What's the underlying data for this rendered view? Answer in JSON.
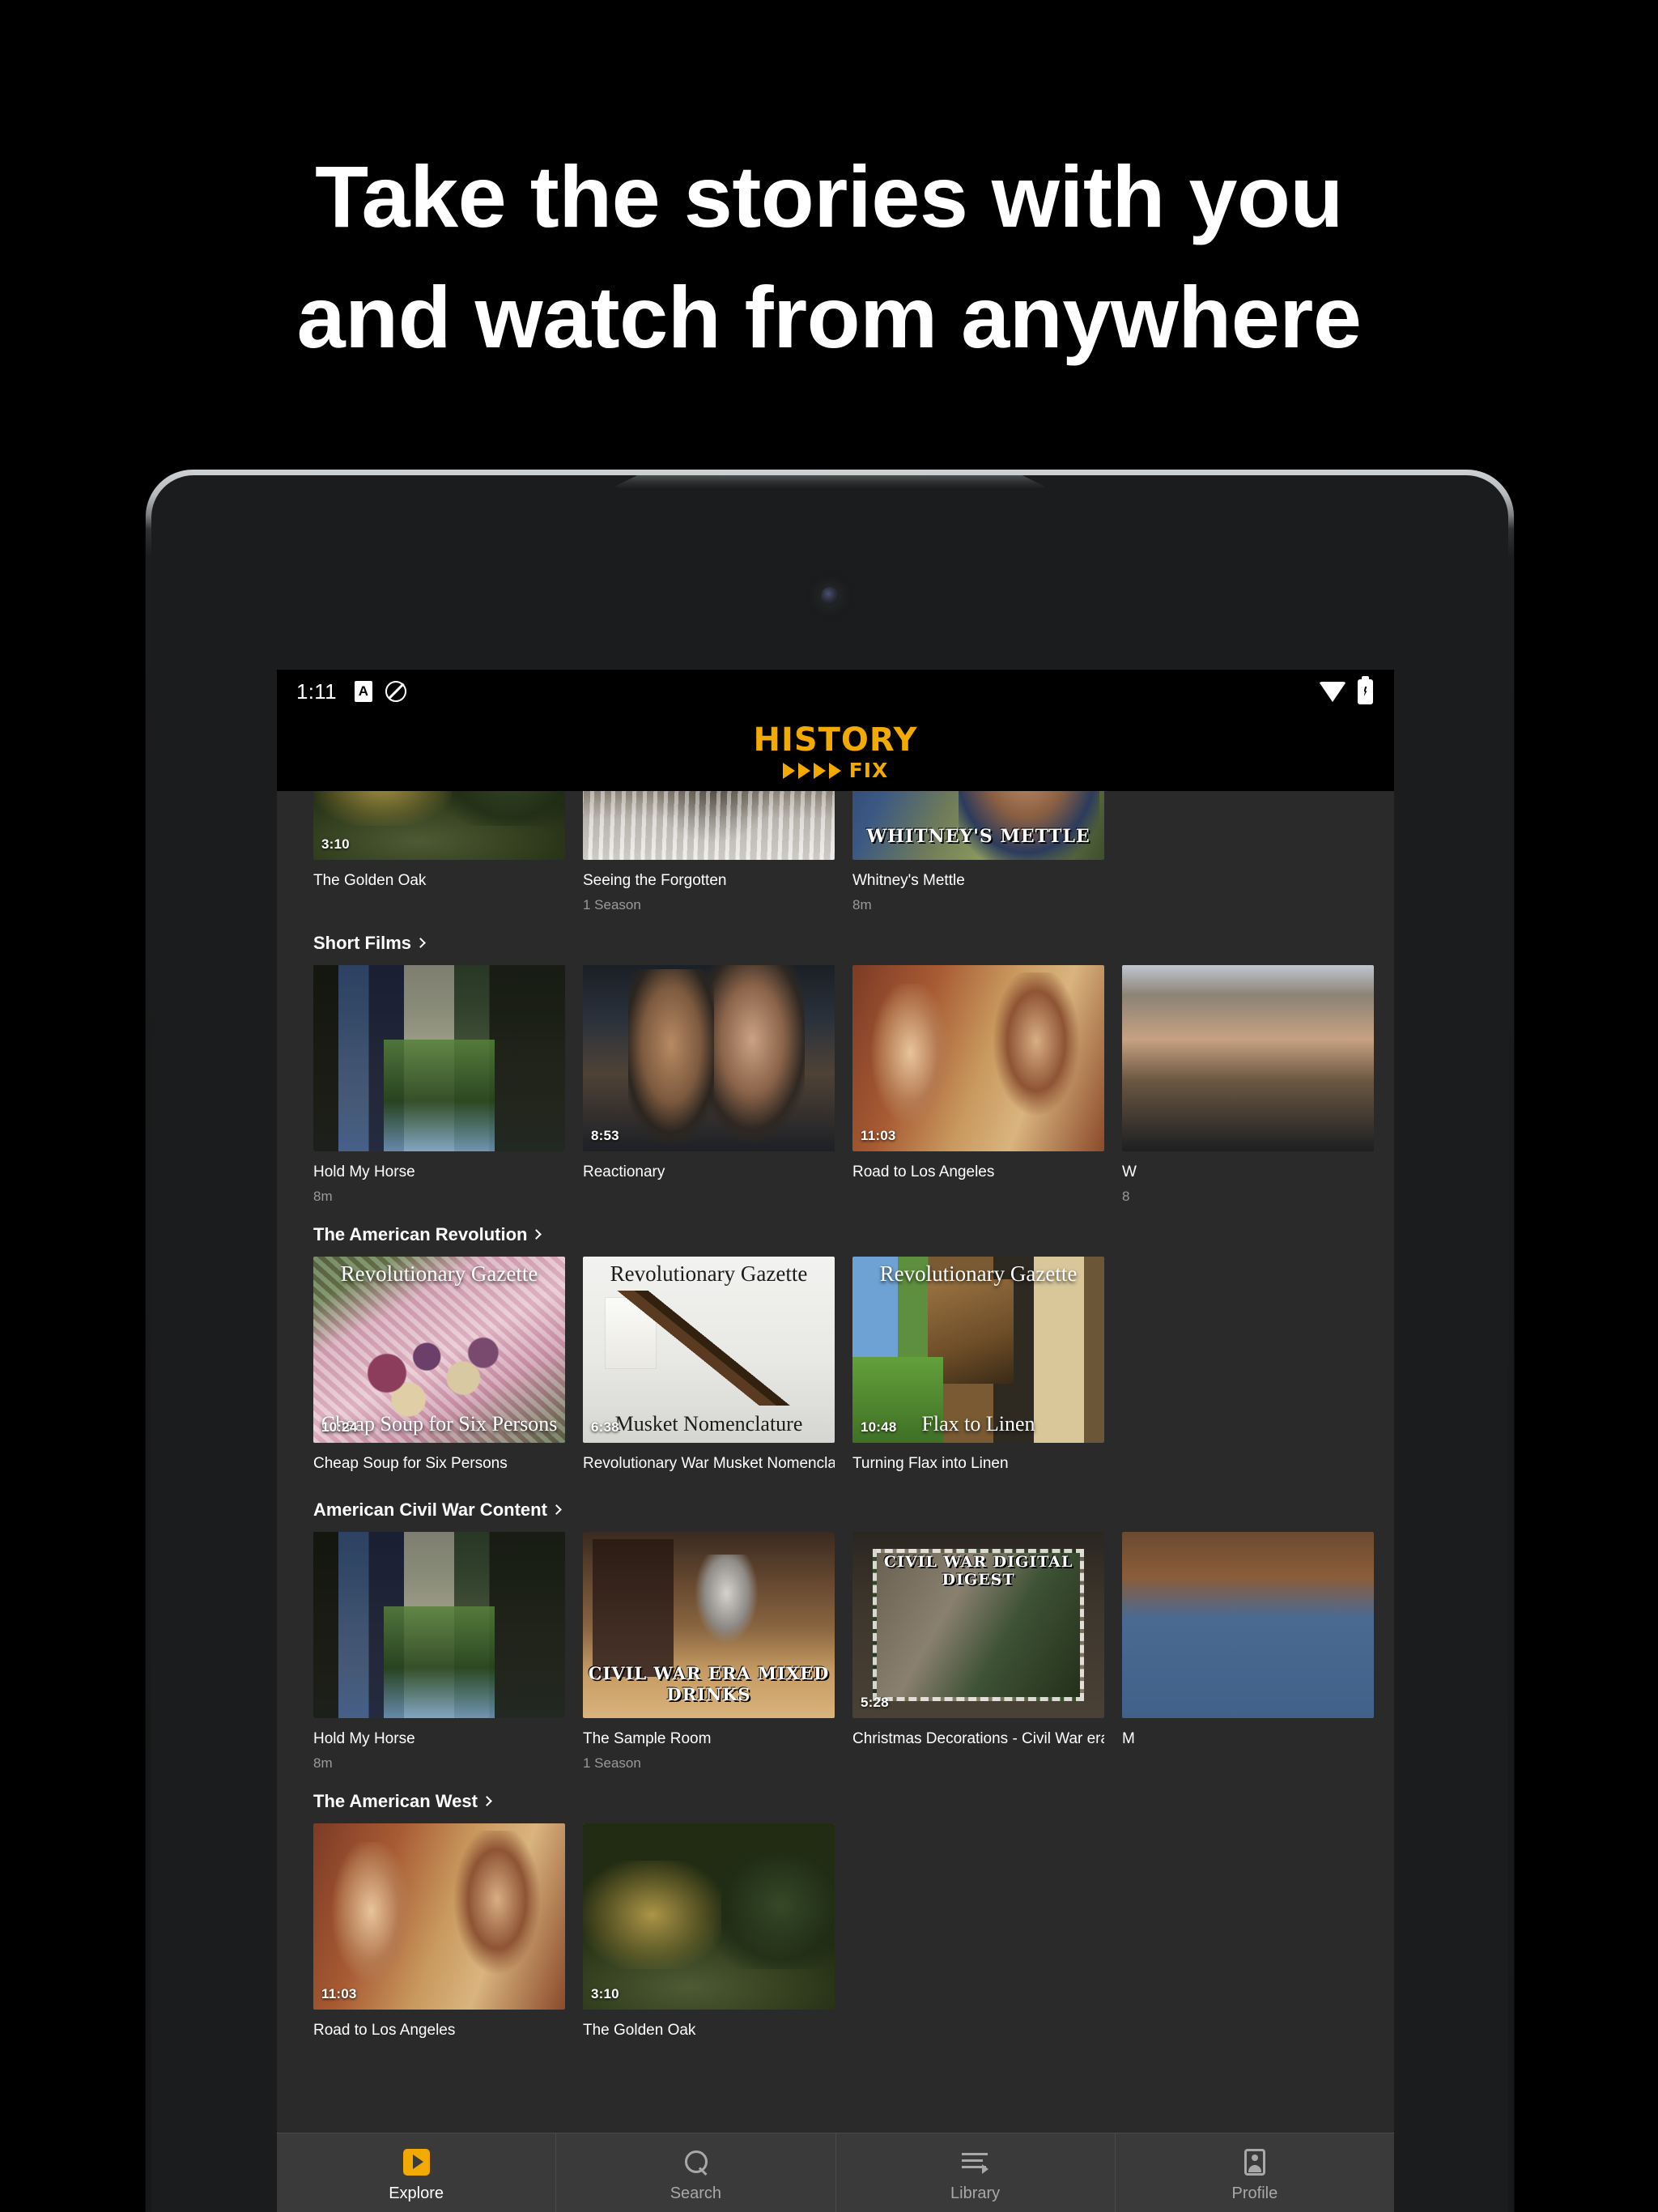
{
  "marketing": {
    "headline_line1": "Take the stories with you",
    "headline_line2": "and watch from anywhere"
  },
  "colors": {
    "brand_amber": "#F2A900",
    "app_background": "#2a2a2a",
    "nav_background": "#3a3a3a",
    "status_bar": "#000000"
  },
  "status_bar": {
    "time": "1:11",
    "left_icons": [
      "alarm-a-icon",
      "do-not-disturb-icon"
    ],
    "right_icons": [
      "wifi-icon",
      "battery-charging-icon"
    ]
  },
  "app_header": {
    "logo_main": "HISTORY",
    "logo_sub": "FIX",
    "triangle_count": 4
  },
  "rows": [
    {
      "title": "",
      "has_chevron": false,
      "partial_top_row": true,
      "cards": [
        {
          "title": "The Golden Oak",
          "subtitle": "",
          "duration": "3:10",
          "art": "art-golden-oak",
          "overlay_top": "",
          "overlay_bottom": ""
        },
        {
          "title": "Seeing the Forgotten",
          "subtitle": "1 Season",
          "duration": "",
          "art": "art-forgotten",
          "overlay_top": "",
          "overlay_bottom": ""
        },
        {
          "title": "Whitney's Mettle",
          "subtitle": "8m",
          "duration": "",
          "art": "art-whitney",
          "overlay_top": "",
          "overlay_bottom": "WHITNEY'S METTLE"
        }
      ]
    },
    {
      "title": "Short Films",
      "has_chevron": true,
      "cards": [
        {
          "title": "Hold My Horse",
          "subtitle": "8m",
          "duration": "",
          "art": "art-hold-my-horse",
          "overlay_top": "",
          "overlay_bottom": ""
        },
        {
          "title": "Reactionary",
          "subtitle": "",
          "duration": "8:53",
          "art": "art-reactionary",
          "overlay_top": "",
          "overlay_bottom": ""
        },
        {
          "title": "Road to Los Angeles",
          "subtitle": "",
          "duration": "11:03",
          "art": "art-road-la",
          "overlay_top": "",
          "overlay_bottom": ""
        },
        {
          "title": "W",
          "subtitle": "8",
          "duration": "",
          "art": "art-cut-whitney",
          "overlay_top": "",
          "overlay_bottom": "",
          "clipped": true
        }
      ]
    },
    {
      "title": "The American Revolution",
      "has_chevron": true,
      "cards": [
        {
          "title": "Cheap Soup for Six Persons",
          "subtitle": "",
          "duration": "10:24",
          "art": "art-soup",
          "overlay_top": "Revolutionary Gazette",
          "overlay_bottom": "Cheap Soup for Six Persons"
        },
        {
          "title": "Revolutionary War Musket Nomenclature",
          "subtitle": "",
          "duration": "6:38",
          "art": "art-musket",
          "overlay_top": "Revolutionary Gazette",
          "overlay_bottom": "Musket Nomenclature"
        },
        {
          "title": "Turning Flax into Linen",
          "subtitle": "",
          "duration": "10:48",
          "art": "art-flax",
          "overlay_top": "Revolutionary Gazette",
          "overlay_bottom": "Flax to Linen"
        }
      ]
    },
    {
      "title": "American Civil War Content",
      "has_chevron": true,
      "cards": [
        {
          "title": "Hold My Horse",
          "subtitle": "8m",
          "duration": "",
          "art": "art-hold-my-horse",
          "overlay_top": "",
          "overlay_bottom": ""
        },
        {
          "title": "The Sample Room",
          "subtitle": "1 Season",
          "duration": "",
          "art": "art-sample-room",
          "overlay_top": "",
          "overlay_bottom": "CIVIL WAR ERA MIXED DRINKS"
        },
        {
          "title": "Christmas Decorations - Civil War era",
          "subtitle": "",
          "duration": "5:28",
          "art": "art-christmas",
          "overlay_top": "CIVIL WAR DIGITAL DIGEST",
          "overlay_bottom": ""
        },
        {
          "title": "M",
          "subtitle": "",
          "duration": "",
          "art": "art-cut-blue",
          "overlay_top": "",
          "overlay_bottom": "",
          "clipped": true
        }
      ]
    },
    {
      "title": "The American West",
      "has_chevron": true,
      "cards": [
        {
          "title": "Road to Los Angeles",
          "subtitle": "",
          "duration": "11:03",
          "art": "art-road-la",
          "overlay_top": "",
          "overlay_bottom": ""
        },
        {
          "title": "The Golden Oak",
          "subtitle": "",
          "duration": "3:10",
          "art": "art-golden-oak",
          "overlay_top": "",
          "overlay_bottom": ""
        }
      ]
    }
  ],
  "bottom_nav": {
    "items": [
      {
        "label": "Explore",
        "icon": "explore-play-icon",
        "active": true
      },
      {
        "label": "Search",
        "icon": "search-icon",
        "active": false
      },
      {
        "label": "Library",
        "icon": "library-list-icon",
        "active": false
      },
      {
        "label": "Profile",
        "icon": "profile-person-icon",
        "active": false
      }
    ]
  }
}
